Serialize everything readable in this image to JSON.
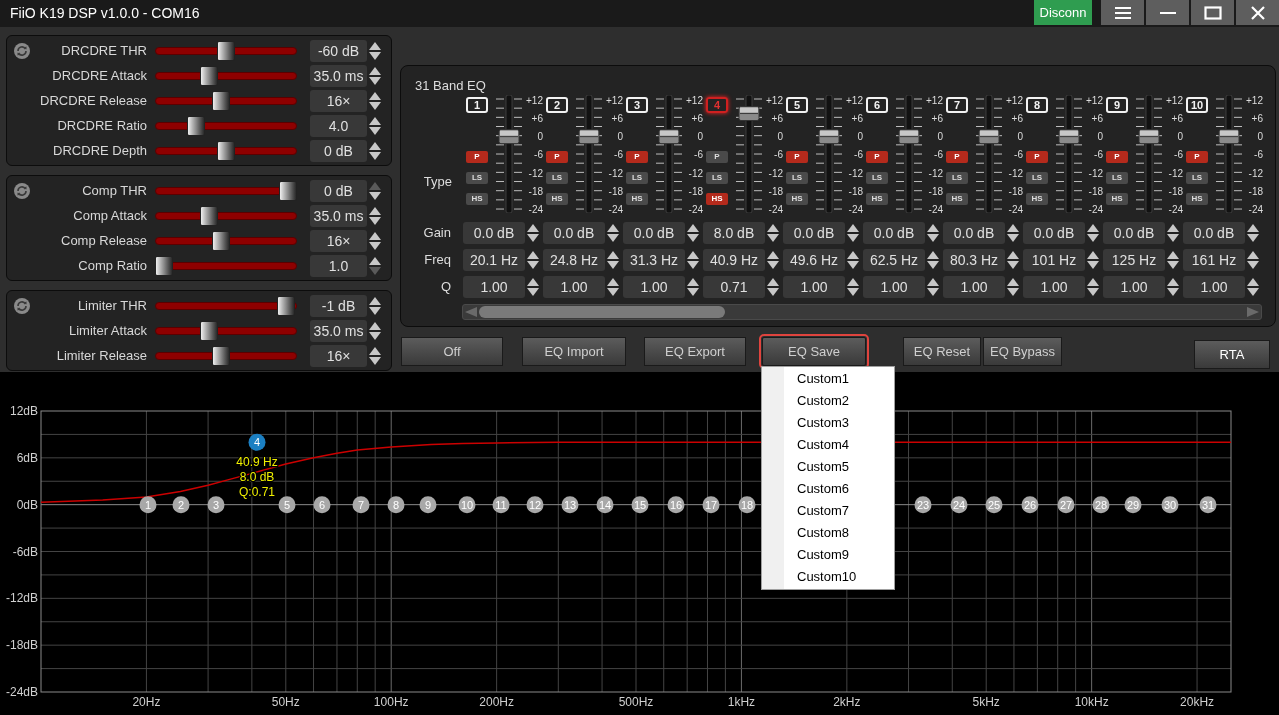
{
  "window": {
    "title": "FiiO K19 DSP v1.0.0 - COM16",
    "connect_button": "Disconn"
  },
  "dynamics_panels": [
    {
      "rows": [
        {
          "label": "DRCDRE THR",
          "level": 0.5,
          "value": "-60 dB",
          "up_disabled": false,
          "down_disabled": false
        },
        {
          "label": "DRCDRE Attack",
          "level": 0.36,
          "value": "35.0 ms",
          "up_disabled": false,
          "down_disabled": false
        },
        {
          "label": "DRCDRE Release",
          "level": 0.46,
          "value": "16×",
          "up_disabled": false,
          "down_disabled": false
        },
        {
          "label": "DRCDRE Ratio",
          "level": 0.26,
          "value": "4.0",
          "up_disabled": false,
          "down_disabled": false
        },
        {
          "label": "DRCDRE Depth",
          "level": 0.5,
          "value": "0 dB",
          "up_disabled": false,
          "down_disabled": false
        }
      ]
    },
    {
      "rows": [
        {
          "label": "Comp THR",
          "level": 1,
          "value": "0 dB",
          "up_disabled": true,
          "down_disabled": false
        },
        {
          "label": "Comp Attack",
          "level": 0.36,
          "value": "35.0 ms",
          "up_disabled": false,
          "down_disabled": false
        },
        {
          "label": "Comp Release",
          "level": 0.46,
          "value": "16×",
          "up_disabled": false,
          "down_disabled": false
        },
        {
          "label": "Comp Ratio",
          "level": 0,
          "value": "1.0",
          "up_disabled": false,
          "down_disabled": true
        }
      ]
    },
    {
      "rows": [
        {
          "label": "Limiter THR",
          "level": 0.98,
          "value": "-1 dB",
          "up_disabled": false,
          "down_disabled": false
        },
        {
          "label": "Limiter Attack",
          "level": 0.36,
          "value": "35.0 ms",
          "up_disabled": false,
          "down_disabled": false
        },
        {
          "label": "Limiter Release",
          "level": 0.46,
          "value": "16×",
          "up_disabled": false,
          "down_disabled": false
        }
      ]
    }
  ],
  "eq": {
    "title": "31 Band EQ",
    "row_labels": {
      "type": "Type",
      "gain": "Gain",
      "freq": "Freq",
      "q": "Q"
    },
    "bands": [
      {
        "number": "1",
        "selected": false,
        "types": [
          {
            "label": "P",
            "selected": true
          },
          {
            "label": "LS",
            "selected": false
          },
          {
            "label": "HS",
            "selected": false
          }
        ],
        "level": 0.667,
        "scale": [
          "+12",
          "+6",
          "0",
          "-6",
          "-12",
          "-18",
          "-24"
        ],
        "gain": "0.0 dB",
        "freq": "20.1 Hz",
        "q": "1.00"
      },
      {
        "number": "2",
        "selected": false,
        "types": [
          {
            "label": "P",
            "selected": true
          },
          {
            "label": "LS",
            "selected": false
          },
          {
            "label": "HS",
            "selected": false
          }
        ],
        "level": 0.667,
        "scale": [
          "+12",
          "+6",
          "0",
          "-6",
          "-12",
          "-18",
          "-24"
        ],
        "gain": "0.0 dB",
        "freq": "24.8 Hz",
        "q": "1.00"
      },
      {
        "number": "3",
        "selected": false,
        "types": [
          {
            "label": "P",
            "selected": true
          },
          {
            "label": "LS",
            "selected": false
          },
          {
            "label": "HS",
            "selected": false
          }
        ],
        "level": 0.667,
        "scale": [
          "+12",
          "+6",
          "0",
          "-6",
          "-12",
          "-18",
          "-24"
        ],
        "gain": "0.0 dB",
        "freq": "31.3 Hz",
        "q": "1.00"
      },
      {
        "number": "4",
        "selected": true,
        "types": [
          {
            "label": "P",
            "selected": false
          },
          {
            "label": "LS",
            "selected": false
          },
          {
            "label": "HS",
            "selected": true
          }
        ],
        "level": 0.889,
        "scale": [
          "+12",
          "+6",
          "0",
          "-6",
          "-12",
          "-18",
          "-24"
        ],
        "gain": "8.0 dB",
        "freq": "40.9 Hz",
        "q": "0.71"
      },
      {
        "number": "5",
        "selected": false,
        "types": [
          {
            "label": "P",
            "selected": true
          },
          {
            "label": "LS",
            "selected": false
          },
          {
            "label": "HS",
            "selected": false
          }
        ],
        "level": 0.667,
        "scale": [
          "+12",
          "+6",
          "0",
          "-6",
          "-12",
          "-18",
          "-24"
        ],
        "gain": "0.0 dB",
        "freq": "49.6 Hz",
        "q": "1.00"
      },
      {
        "number": "6",
        "selected": false,
        "types": [
          {
            "label": "P",
            "selected": true
          },
          {
            "label": "LS",
            "selected": false
          },
          {
            "label": "HS",
            "selected": false
          }
        ],
        "level": 0.667,
        "scale": [
          "+12",
          "+6",
          "0",
          "-6",
          "-12",
          "-18",
          "-24"
        ],
        "gain": "0.0 dB",
        "freq": "62.5 Hz",
        "q": "1.00"
      },
      {
        "number": "7",
        "selected": false,
        "types": [
          {
            "label": "P",
            "selected": true
          },
          {
            "label": "LS",
            "selected": false
          },
          {
            "label": "HS",
            "selected": false
          }
        ],
        "level": 0.667,
        "scale": [
          "+12",
          "+6",
          "0",
          "-6",
          "-12",
          "-18",
          "-24"
        ],
        "gain": "0.0 dB",
        "freq": "80.3 Hz",
        "q": "1.00"
      },
      {
        "number": "8",
        "selected": false,
        "types": [
          {
            "label": "P",
            "selected": true
          },
          {
            "label": "LS",
            "selected": false
          },
          {
            "label": "HS",
            "selected": false
          }
        ],
        "level": 0.667,
        "scale": [
          "+12",
          "+6",
          "0",
          "-6",
          "-12",
          "-18",
          "-24"
        ],
        "gain": "0.0 dB",
        "freq": "101 Hz",
        "q": "1.00"
      },
      {
        "number": "9",
        "selected": false,
        "types": [
          {
            "label": "P",
            "selected": true
          },
          {
            "label": "LS",
            "selected": false
          },
          {
            "label": "HS",
            "selected": false
          }
        ],
        "level": 0.667,
        "scale": [
          "+12",
          "+6",
          "0",
          "-6",
          "-12",
          "-18",
          "-24"
        ],
        "gain": "0.0 dB",
        "freq": "125 Hz",
        "q": "1.00"
      },
      {
        "number": "10",
        "selected": false,
        "types": [
          {
            "label": "P",
            "selected": true
          },
          {
            "label": "LS",
            "selected": false
          },
          {
            "label": "HS",
            "selected": false
          }
        ],
        "level": 0.667,
        "scale": [
          "+12",
          "+6",
          "0",
          "-6",
          "-12",
          "-18",
          "-24"
        ],
        "gain": "0.0 dB",
        "freq": "161 Hz",
        "q": "1.00"
      }
    ]
  },
  "buttons": [
    {
      "label": "Off",
      "focused": false
    },
    {
      "label": "EQ Import",
      "focused": false
    },
    {
      "label": "EQ Export",
      "focused": false
    },
    {
      "label": "EQ Save",
      "focused": true
    },
    {
      "label": "EQ Reset",
      "focused": false
    },
    {
      "label": "EQ Bypass",
      "focused": false
    },
    {
      "label": "RTA",
      "focused": false
    }
  ],
  "save_menu": [
    "Custom1",
    "Custom2",
    "Custom3",
    "Custom4",
    "Custom5",
    "Custom6",
    "Custom7",
    "Custom8",
    "Custom9",
    "Custom10"
  ],
  "graph": {
    "y_labels": [
      "12dB",
      "6dB",
      "0dB",
      "-6dB",
      "-12dB",
      "-18dB",
      "-24dB"
    ],
    "x_labels": [
      "20Hz",
      "50Hz",
      "100Hz",
      "200Hz",
      "500Hz",
      "1kHz",
      "2kHz",
      "5kHz",
      "10kHz",
      "20kHz"
    ],
    "markers": [
      {
        "label": "1",
        "selected": false
      },
      {
        "label": "2",
        "selected": false
      },
      {
        "label": "3",
        "selected": false
      },
      {
        "label": "4",
        "selected": true,
        "readout": [
          "40.9 Hz",
          "8.0 dB",
          "Q:0.71"
        ]
      },
      {
        "label": "5",
        "selected": false
      },
      {
        "label": "6",
        "selected": false
      },
      {
        "label": "7",
        "selected": false
      },
      {
        "label": "8",
        "selected": false
      },
      {
        "label": "9",
        "selected": false
      },
      {
        "label": "10",
        "selected": false
      },
      {
        "label": "11",
        "selected": false
      },
      {
        "label": "12",
        "selected": false
      },
      {
        "label": "13",
        "selected": false
      },
      {
        "label": "14",
        "selected": false
      },
      {
        "label": "15",
        "selected": false
      },
      {
        "label": "16",
        "selected": false
      },
      {
        "label": "17",
        "selected": false
      },
      {
        "label": "18",
        "selected": false
      },
      {
        "label": "23",
        "selected": false
      },
      {
        "label": "24",
        "selected": false
      },
      {
        "label": "25",
        "selected": false
      },
      {
        "label": "26",
        "selected": false
      },
      {
        "label": "27",
        "selected": false
      },
      {
        "label": "28",
        "selected": false
      },
      {
        "label": "29",
        "selected": false
      },
      {
        "label": "30",
        "selected": false
      },
      {
        "label": "31",
        "selected": false
      }
    ]
  }
}
